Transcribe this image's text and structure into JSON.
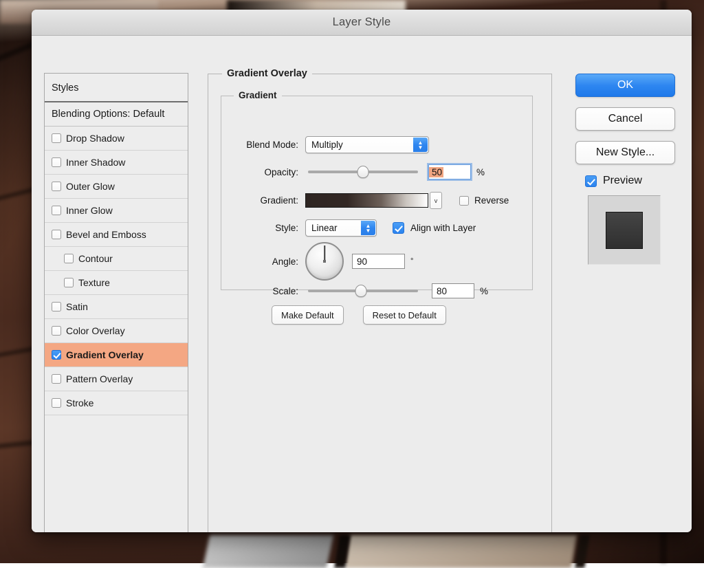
{
  "window": {
    "title": "Layer Style"
  },
  "styles_panel": {
    "header": "Styles",
    "blending_option": "Blending Options: Default",
    "items": [
      {
        "label": "Drop Shadow",
        "checked": false,
        "indent": false
      },
      {
        "label": "Inner Shadow",
        "checked": false,
        "indent": false
      },
      {
        "label": "Outer Glow",
        "checked": false,
        "indent": false
      },
      {
        "label": "Inner Glow",
        "checked": false,
        "indent": false
      },
      {
        "label": "Bevel and Emboss",
        "checked": false,
        "indent": false
      },
      {
        "label": "Contour",
        "checked": false,
        "indent": true
      },
      {
        "label": "Texture",
        "checked": false,
        "indent": true
      },
      {
        "label": "Satin",
        "checked": false,
        "indent": false
      },
      {
        "label": "Color Overlay",
        "checked": false,
        "indent": false
      },
      {
        "label": "Gradient Overlay",
        "checked": true,
        "indent": false,
        "selected": true
      },
      {
        "label": "Pattern Overlay",
        "checked": false,
        "indent": false
      },
      {
        "label": "Stroke",
        "checked": false,
        "indent": false
      }
    ],
    "selection_color": "#f4a783"
  },
  "main": {
    "group_title": "Gradient Overlay",
    "subgroup_title": "Gradient",
    "blend_mode": {
      "label": "Blend Mode:",
      "value": "Multiply"
    },
    "opacity": {
      "label": "Opacity:",
      "value": "50",
      "unit": "%",
      "slider_percent": 50,
      "selected": true
    },
    "gradient": {
      "label": "Gradient:",
      "dropdown_glyph": "v",
      "stops": [
        "#2e2522",
        "#332824",
        "#6d6059",
        "#c9c3bd",
        "#ffffff"
      ]
    },
    "reverse": {
      "label": "Reverse",
      "checked": false
    },
    "style": {
      "label": "Style:",
      "value": "Linear"
    },
    "align": {
      "label": "Align with Layer",
      "checked": true
    },
    "angle": {
      "label": "Angle:",
      "value": "90",
      "unit": "°",
      "degrees": 90
    },
    "scale": {
      "label": "Scale:",
      "value": "80",
      "unit": "%",
      "slider_percent": 48
    },
    "make_default": "Make Default",
    "reset_default": "Reset to Default"
  },
  "actions": {
    "ok": "OK",
    "cancel": "Cancel",
    "new_style": "New Style...",
    "preview_label": "Preview",
    "preview_checked": true,
    "accent_color": "#2d86f0"
  }
}
